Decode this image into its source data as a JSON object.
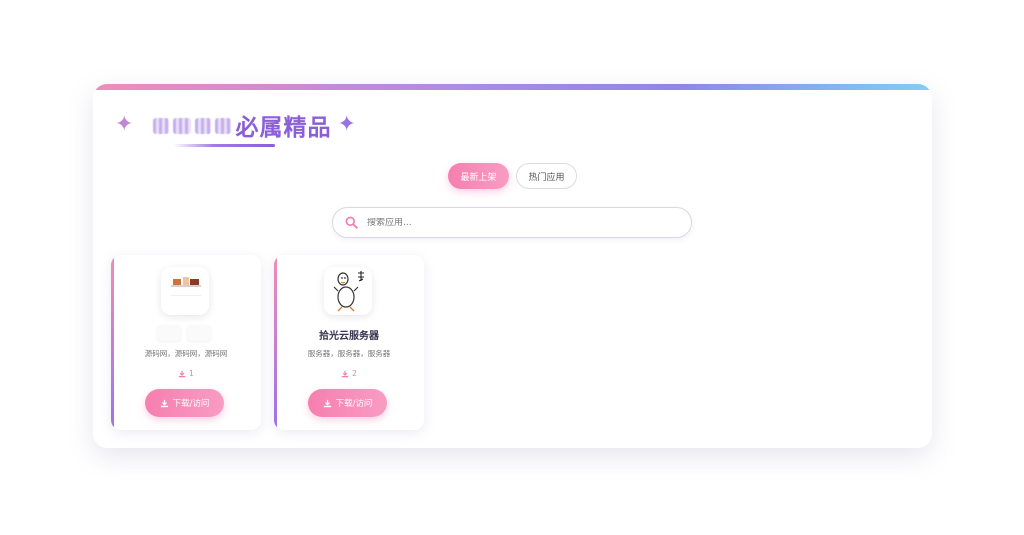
{
  "header": {
    "title": "必属精品",
    "sparkle_left": "✦",
    "sparkle_right": "✦"
  },
  "tabs": [
    {
      "label": "最新上架",
      "active": true
    },
    {
      "label": "热门应用",
      "active": false
    }
  ],
  "search": {
    "placeholder": "搜索应用...",
    "value": ""
  },
  "apps": [
    {
      "name": "",
      "desc": "源码网，源码网，源码网",
      "downloads": "1",
      "button": "下载/访问",
      "icon": "app-thumbnail-icon"
    },
    {
      "name": "拾光云服务器",
      "desc": "服务器，服务器，服务器",
      "downloads": "2",
      "button": "下载/访问",
      "icon": "goose-sticker-icon"
    }
  ],
  "colors": {
    "accent_pink": "#f67fb0",
    "accent_purple": "#8a5fd8",
    "gradient_blue": "#7ed0f5"
  }
}
